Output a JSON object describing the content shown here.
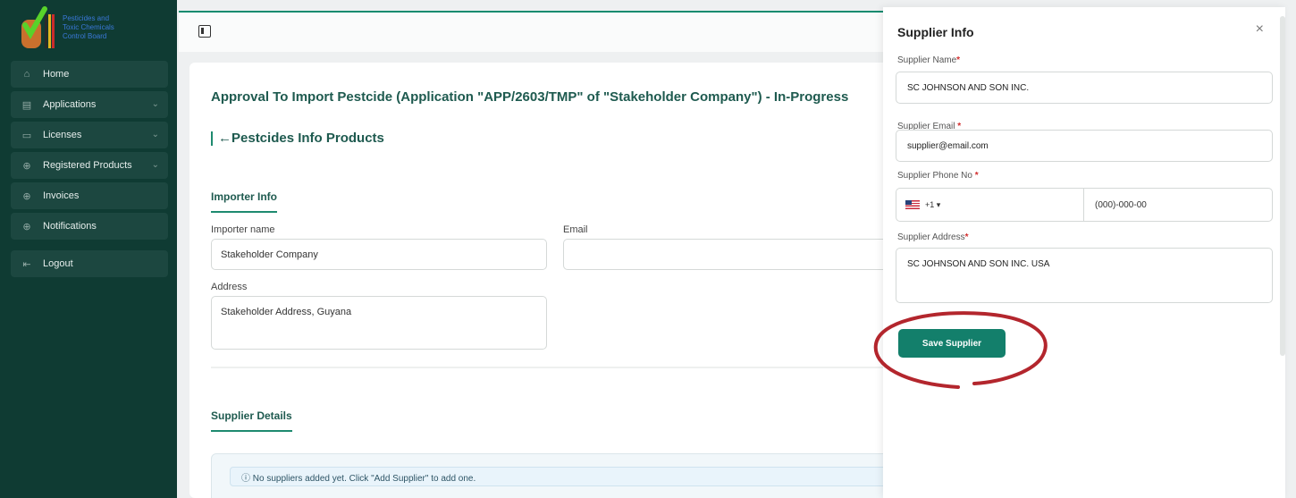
{
  "sidebar": {
    "logo_text": "Pesticides and Toxic Chemicals Control Board",
    "items": [
      {
        "label": "Home",
        "icon": "home-icon",
        "chevron": false
      },
      {
        "label": "Applications",
        "icon": "document-icon",
        "chevron": true
      },
      {
        "label": "Licenses",
        "icon": "card-icon",
        "chevron": true
      },
      {
        "label": "Registered Products",
        "icon": "globe-icon",
        "chevron": true
      },
      {
        "label": "Invoices",
        "icon": "globe-icon",
        "chevron": false
      },
      {
        "label": "Notifications",
        "icon": "globe-icon",
        "chevron": false
      }
    ],
    "logout": "Logout"
  },
  "main": {
    "title": "Approval To Import Pestcide  (Application \"APP/2603/TMP\" of \"Stakeholder Company\") - In-Progress",
    "subtitle": "←Pestcides Info Products",
    "importer_section": "Importer Info",
    "importer_name_label": "Importer name",
    "importer_name_value": "Stakeholder Company",
    "email_label": "Email",
    "email_value": "",
    "address_label": "Address",
    "address_value": "Stakeholder Address, Guyana",
    "supplier_section": "Supplier Details",
    "notice": "ⓘ No suppliers added yet. Click \"Add Supplier\" to add one."
  },
  "drawer": {
    "title": "Supplier Info",
    "close": "×",
    "name_label": "Supplier Name",
    "name_value": "SC JOHNSON AND SON INC.",
    "email_label": "Supplier Email ",
    "email_value": "supplier@email.com",
    "phone_label": "Supplier Phone No ",
    "phone_cc": "+1 ▾",
    "phone_value": "(000)-000-00",
    "address_label": "Supplier Address",
    "address_value": "SC JOHNSON AND SON INC. USA",
    "required_mark": "*",
    "save_label": "Save Supplier"
  },
  "colors": {
    "sidebar_bg": "#0f3b33",
    "accent": "#137f6b",
    "title": "#1e5a4f",
    "annotation": "#b3262d"
  }
}
